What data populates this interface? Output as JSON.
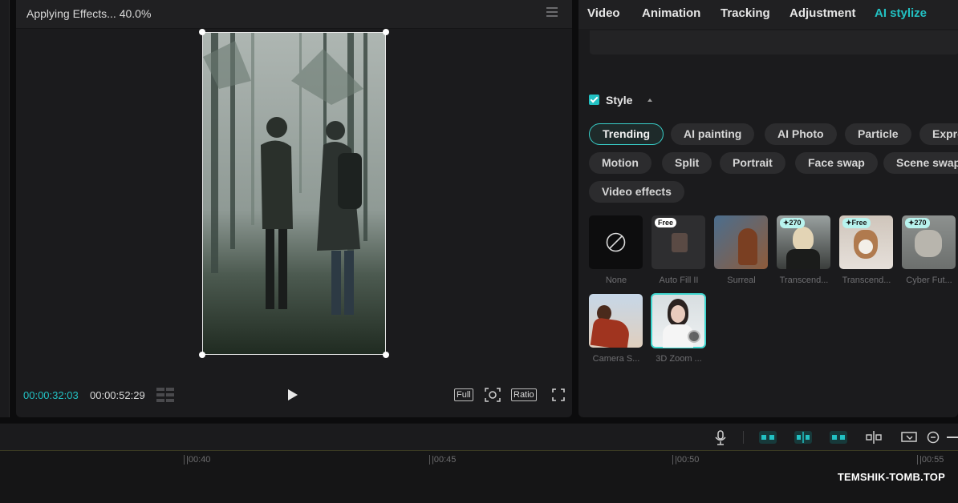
{
  "player": {
    "status": "Applying Effects... 40.0%",
    "current_time": "00:00:32:03",
    "total_time": "00:00:52:29",
    "buttons": {
      "full": "Full",
      "ratio": "Ratio"
    }
  },
  "panel": {
    "tabs": [
      {
        "label": "Video"
      },
      {
        "label": "Animation"
      },
      {
        "label": "Tracking"
      },
      {
        "label": "Adjustment"
      },
      {
        "label": "AI stylize",
        "active": true
      }
    ],
    "style_label": "Style",
    "chips": [
      {
        "label": "Trending",
        "active": true
      },
      {
        "label": "AI painting"
      },
      {
        "label": "AI Photo"
      },
      {
        "label": "Particle"
      },
      {
        "label": "Expre"
      },
      {
        "label": "Motion"
      },
      {
        "label": "Split"
      },
      {
        "label": "Portrait"
      },
      {
        "label": "Face swap"
      },
      {
        "label": "Scene swap"
      },
      {
        "label": "Video effects"
      }
    ],
    "tiles": [
      {
        "label": "None",
        "badge": ""
      },
      {
        "label": "Auto Fill II",
        "badge": "Free"
      },
      {
        "label": "Surreal",
        "badge": ""
      },
      {
        "label": "Transcend...",
        "badge": "✦270"
      },
      {
        "label": "Transcend...",
        "badge": "✦Free"
      },
      {
        "label": "Cyber Fut...",
        "badge": "✦270"
      },
      {
        "label": "Camera S...",
        "badge": ""
      },
      {
        "label": "3D Zoom ...",
        "badge": "",
        "selected": true
      }
    ]
  },
  "timeline": {
    "ticks": [
      "|00:40",
      "|00:45",
      "|00:50",
      "|00:55"
    ]
  },
  "watermark": "TEMSHIK-TOMB.TOP",
  "colors": {
    "accent": "#22c1c3",
    "panel": "#1b1b1d",
    "background": "#0c0c0d"
  }
}
